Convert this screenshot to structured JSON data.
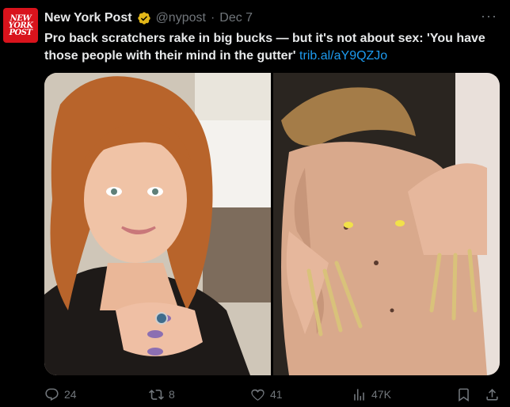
{
  "author": {
    "name": "New York Post",
    "handle": "@nypost",
    "separator": "·",
    "date": "Dec 7",
    "avatar_text": "NEW\nYORK\nPOST"
  },
  "tweet": {
    "text": "Pro back scratchers rake in big bucks — but it's not about sex: 'You have those people with their mind in the gutter'",
    "link": "trib.al/aY9QZJo"
  },
  "more_label": "···",
  "actions": {
    "replies": "24",
    "reposts": "8",
    "likes": "41",
    "views": "47K"
  },
  "colors": {
    "background": "#000000",
    "text": "#e7e9ea",
    "muted": "#71767b",
    "link": "#1d9bf0",
    "verified_gold": "#e2b719",
    "avatar_red": "#d9131c"
  },
  "icons": [
    "verified-badge-icon",
    "more-icon",
    "reply-icon",
    "repost-icon",
    "like-icon",
    "views-icon",
    "bookmark-icon",
    "share-icon"
  ]
}
